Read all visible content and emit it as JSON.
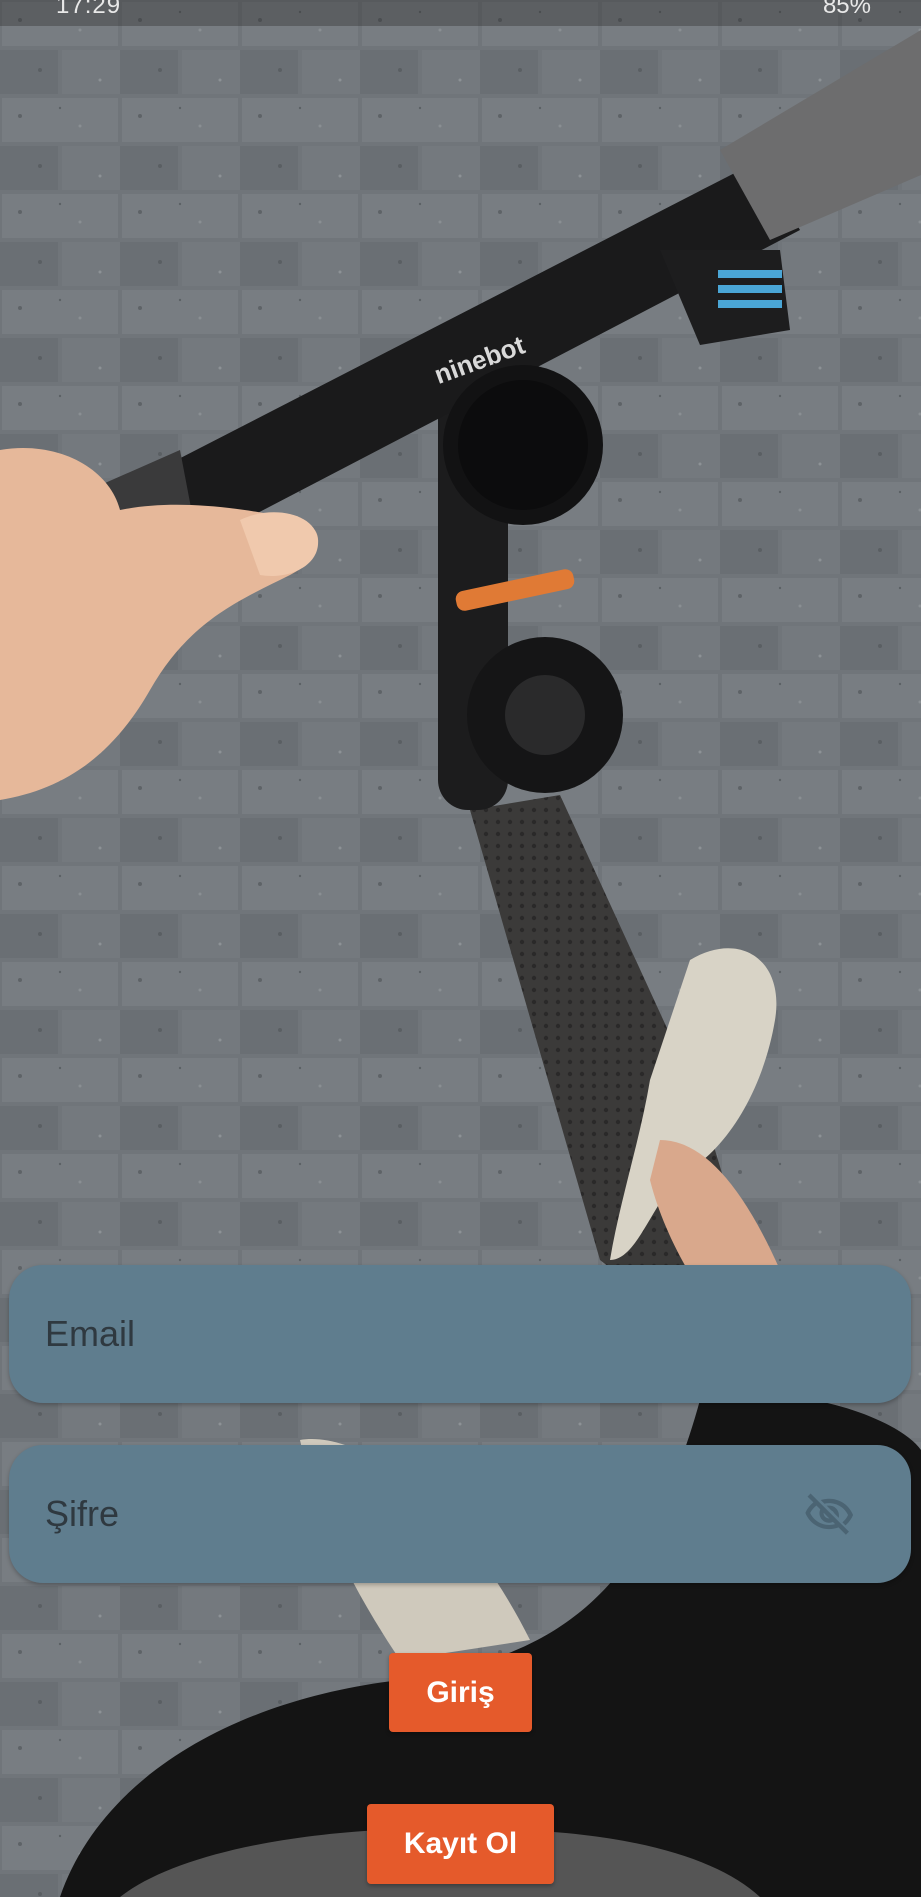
{
  "status_bar": {
    "time": "17:29",
    "battery": "85%"
  },
  "background": {
    "brand_text": "ninebot"
  },
  "login_form": {
    "email_placeholder": "Email",
    "password_placeholder": "Şifre",
    "password_toggle_icon": "eye-off-icon",
    "login_label": "Giriş",
    "register_label": "Kayıt Ol"
  },
  "colors": {
    "field_bg": "#5f7d8e",
    "button_bg": "#e55a2b",
    "button_text": "#ffffff"
  }
}
